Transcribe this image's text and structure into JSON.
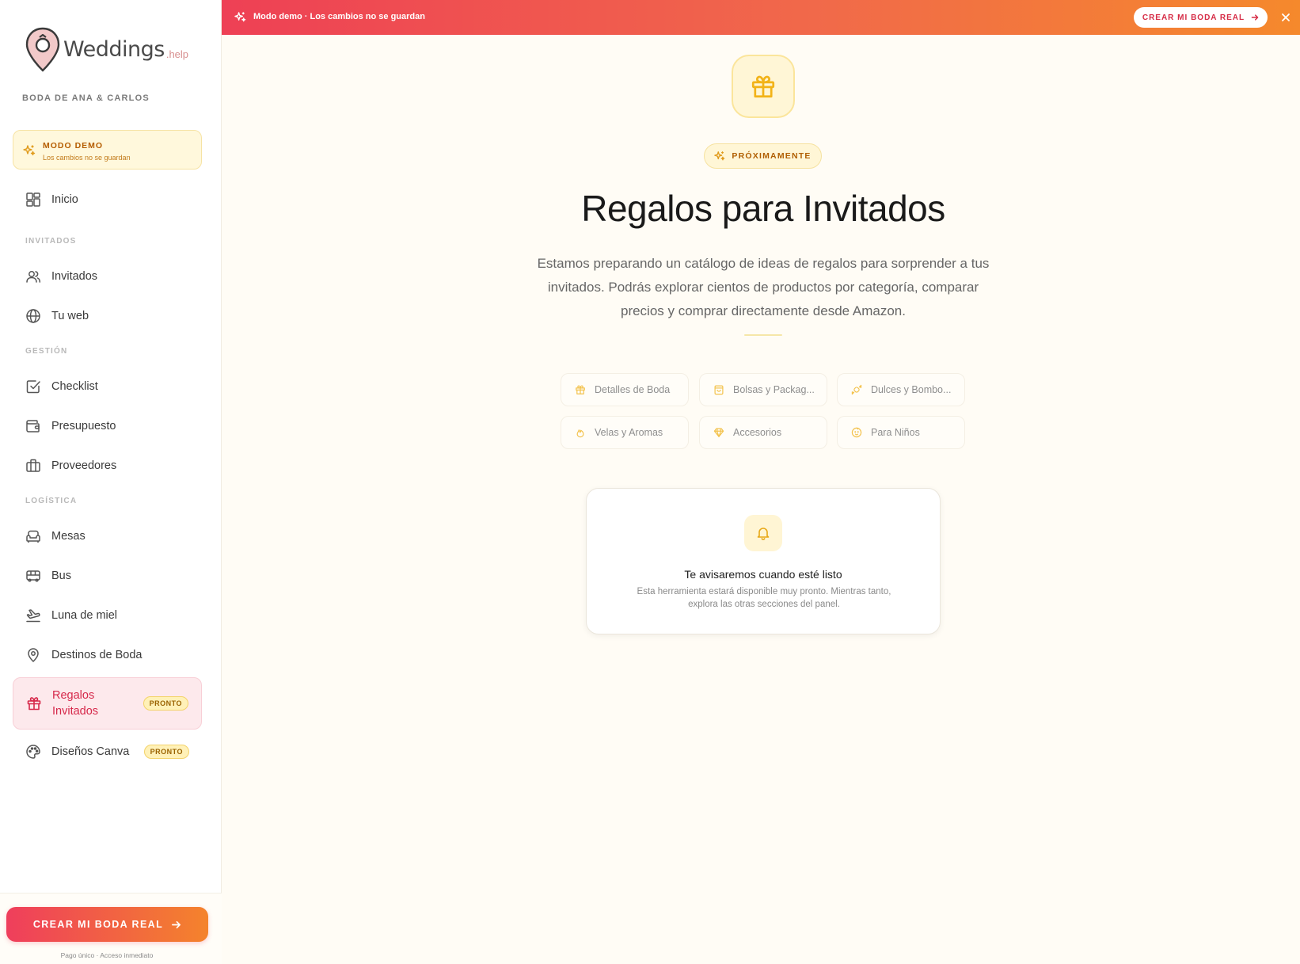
{
  "sidebar": {
    "logo": {
      "word": "Weddings",
      "suffix": ".help"
    },
    "wedding_name": "BODA DE ANA & CARLOS",
    "demo": {
      "title": "MODO DEMO",
      "subtitle": "Los cambios no se guardan"
    },
    "sections": {
      "invitados": "INVITADOS",
      "gestion": "GESTIÓN",
      "logistica": "LOGÍSTICA"
    },
    "items": {
      "inicio": "Inicio",
      "invitados": "Invitados",
      "tu_web": "Tu web",
      "checklist": "Checklist",
      "presupuesto": "Presupuesto",
      "proveedores": "Proveedores",
      "mesas": "Mesas",
      "bus": "Bus",
      "luna_de_miel": "Luna de miel",
      "destinos": "Destinos de Boda",
      "regalos": "Regalos Invitados",
      "canva": "Diseños Canva"
    },
    "badge": "PRONTO",
    "footer": {
      "cta": "CREAR MI BODA REAL",
      "note": "Pago único · Acceso inmediato"
    }
  },
  "banner": {
    "text": "Modo demo · Los cambios no se guardan",
    "cta": "CREAR MI BODA REAL"
  },
  "main": {
    "pill": "PRÓXIMAMENTE",
    "title": "Regalos para Invitados",
    "description": "Estamos preparando un catálogo de ideas de regalos para sorprender a tus invitados. Podrás explorar cientos de productos por categoría, comparar precios y comprar directamente desde Amazon.",
    "categories": [
      "Detalles de Boda",
      "Bolsas y Packag...",
      "Dulces y Bombo...",
      "Velas y Aromas",
      "Accesorios",
      "Para Niños"
    ],
    "notify": {
      "title": "Te avisaremos cuando esté listo",
      "description": "Esta herramienta estará disponible muy pronto. Mientras tanto, explora las otras secciones del panel."
    }
  },
  "colors": {
    "brand_red": "#ef3e5c",
    "brand_orange": "#f4832c",
    "amber": "#f2b318",
    "active_bg": "#fde9ec"
  },
  "icons": {
    "logo": "location-ring-icon",
    "demo": "sparkles-icon",
    "nav": [
      "dashboard-icon",
      "users-icon",
      "globe-icon",
      "checkbox-icon",
      "wallet-icon",
      "briefcase-icon",
      "sofa-icon",
      "bus-icon",
      "plane-icon",
      "map-pin-icon",
      "gift-icon",
      "palette-icon"
    ],
    "categories": [
      "gift-icon",
      "bag-icon",
      "candy-icon",
      "flame-icon",
      "gem-icon",
      "baby-icon"
    ],
    "notify": "bell-icon",
    "close": "close-icon",
    "arrow": "arrow-right-icon"
  }
}
